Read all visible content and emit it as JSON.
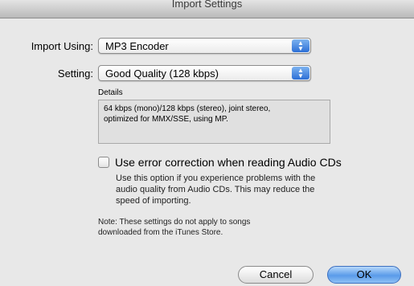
{
  "window": {
    "title": "Import Settings"
  },
  "import_using": {
    "label": "Import Using:",
    "value": "MP3 Encoder"
  },
  "setting": {
    "label": "Setting:",
    "value": "Good Quality (128 kbps)"
  },
  "details": {
    "label": "Details",
    "line1": "64 kbps (mono)/128 kbps (stereo), joint stereo,",
    "line2": "optimized for MMX/SSE, using MP."
  },
  "error_correction": {
    "label": "Use error correction when reading Audio CDs",
    "checked": false,
    "desc_line1": "Use this option if you experience problems with the",
    "desc_line2": "audio quality from Audio CDs.  This may reduce the",
    "desc_line3": "speed of importing."
  },
  "note": {
    "line1": "Note: These settings do not apply to songs",
    "line2": "downloaded from the iTunes Store."
  },
  "buttons": {
    "cancel": "Cancel",
    "ok": "OK"
  },
  "icons": {
    "popup_arrows": "up-down-arrows-icon"
  }
}
